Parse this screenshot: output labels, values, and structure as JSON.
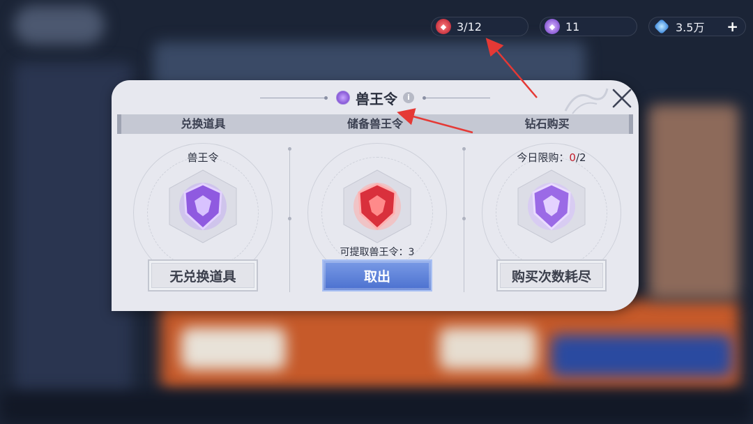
{
  "topbar": {
    "red_token": {
      "value": "3/12",
      "icon": "red-beast-token-icon"
    },
    "purple_token": {
      "value": "11",
      "icon": "purple-beast-token-icon"
    },
    "diamonds": {
      "value": "3.5万",
      "icon": "diamond-icon",
      "add_label": "+"
    }
  },
  "dialog": {
    "title": "兽王令",
    "info_label": "i",
    "close_icon": "close-icon",
    "columns": [
      {
        "header": "兑换道具",
        "caption": "兽王令",
        "medal_color": "#8f5ae0",
        "button_label": "无兑换道具"
      },
      {
        "header": "储备兽王令",
        "note_prefix": "可提取兽王令：",
        "note_value": "3",
        "medal_color": "#d9303c",
        "button_label": "取出"
      },
      {
        "header": "钻石购买",
        "caption_prefix": "今日限购：",
        "caption_count": "0",
        "caption_suffix": "/2",
        "medal_color": "#9b6ae6",
        "button_label": "购买次数耗尽"
      }
    ]
  },
  "colors": {
    "dialog_bg": "#e7e8ef",
    "primary_button": "#5a7fd8",
    "annotation_arrow": "#e53935",
    "limit_count": "#c21d2a"
  }
}
